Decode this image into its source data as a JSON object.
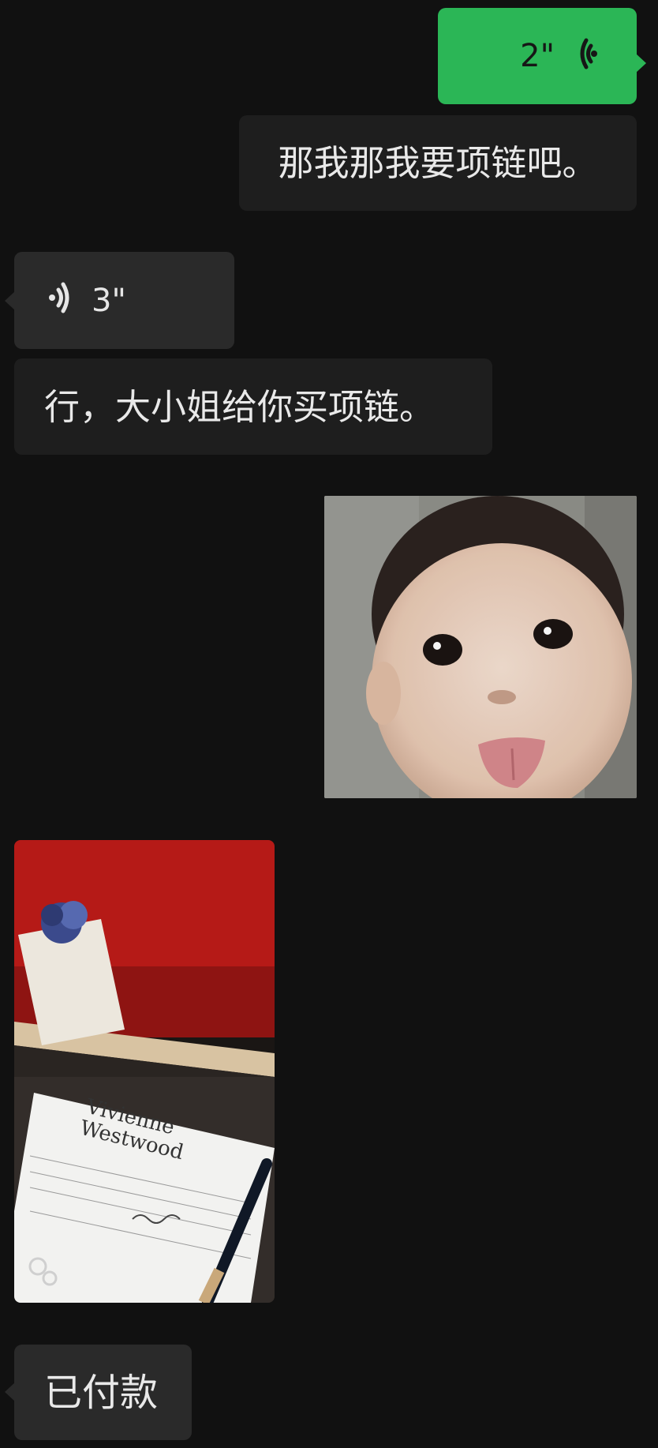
{
  "messages": {
    "voice_out": {
      "duration": "2\"",
      "icon": "voice-wave-icon"
    },
    "text_out": "那我那我要项链吧。",
    "voice_in": {
      "duration": "3\"",
      "icon": "voice-wave-icon"
    },
    "text_in": "行，大小姐给你买项链。",
    "image_baby": {
      "icon": "baby-sticker-image"
    },
    "image_shop": {
      "brand_line1": "Vivienne",
      "brand_line2": "Westwood"
    },
    "text_in2": "已付款"
  },
  "colors": {
    "background": "#111111",
    "outgoing_voice": "#2bb656",
    "bubble_dark": "#1e1e1e",
    "bubble_gray": "#2a2a2a"
  }
}
